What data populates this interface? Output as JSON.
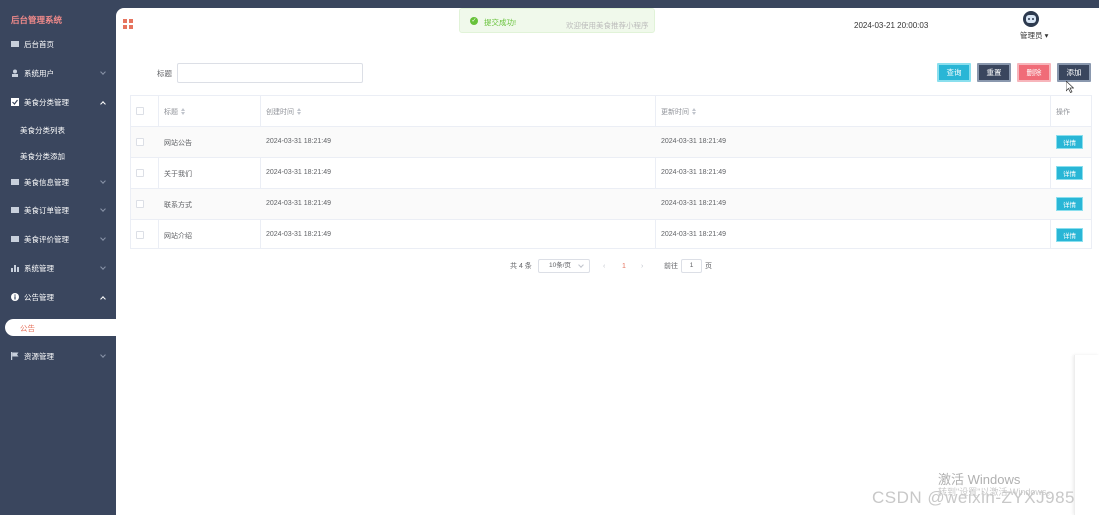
{
  "app": {
    "brand": "后台管理系统"
  },
  "sidebar": {
    "items": [
      {
        "label": "后台首页",
        "icon": "home-icon",
        "expandable": false
      },
      {
        "label": "系统用户",
        "icon": "user-icon",
        "expandable": true,
        "expanded": false
      },
      {
        "label": "美食分类管理",
        "icon": "category-icon",
        "expandable": true,
        "expanded": true
      },
      {
        "label": "美食信息管理",
        "icon": "list-icon",
        "expandable": true,
        "expanded": false
      },
      {
        "label": "美食订单管理",
        "icon": "list-icon",
        "expandable": true,
        "expanded": false
      },
      {
        "label": "美食评价管理",
        "icon": "list-icon",
        "expandable": true,
        "expanded": false
      },
      {
        "label": "系统管理",
        "icon": "chart-icon",
        "expandable": true,
        "expanded": false
      },
      {
        "label": "公告管理",
        "icon": "info-icon",
        "expandable": true,
        "expanded": true
      },
      {
        "label": "资源管理",
        "icon": "flag-icon",
        "expandable": true,
        "expanded": false
      }
    ],
    "sub_category": [
      "美食分类列表",
      "美食分类添加"
    ],
    "sub_notice": [
      "公告"
    ]
  },
  "header": {
    "toast": "提交成功!",
    "welcome": "欢迎使用美食推荐小程序",
    "datetime": "2024-03-21 20:00:03",
    "user": "管理员"
  },
  "search": {
    "label": "标题",
    "value": ""
  },
  "buttons": {
    "query": "查询",
    "reset": "重置",
    "delete": "删除",
    "add": "添加"
  },
  "table": {
    "headers": [
      "标题",
      "创建时间",
      "更新时间",
      "操作"
    ],
    "rows": [
      {
        "title": "网站公告",
        "created": "2024-03-31 18:21:49",
        "updated": "2024-03-31 18:21:49",
        "action": "详情"
      },
      {
        "title": "关于我们",
        "created": "2024-03-31 18:21:49",
        "updated": "2024-03-31 18:21:49",
        "action": "详情"
      },
      {
        "title": "联系方式",
        "created": "2024-03-31 18:21:49",
        "updated": "2024-03-31 18:21:49",
        "action": "详情"
      },
      {
        "title": "网站介绍",
        "created": "2024-03-31 18:21:49",
        "updated": "2024-03-31 18:21:49",
        "action": "详情"
      }
    ]
  },
  "pagination": {
    "total": "共 4 条",
    "page_size": "10条/页",
    "current": "1",
    "goto": "前往",
    "goto_value": "1",
    "page_suffix": "页"
  },
  "watermark": {
    "windows": "激活 Windows",
    "windows_sub": "转到\"设置\"以激活 Windows。",
    "csdn": "CSDN @weixin-ZYXJ985"
  },
  "colors": {
    "sidebar": "#3a465e",
    "accent": "#e6745f",
    "query": "#29b6d6",
    "delete": "#f06c78",
    "success": "#67c23a"
  }
}
